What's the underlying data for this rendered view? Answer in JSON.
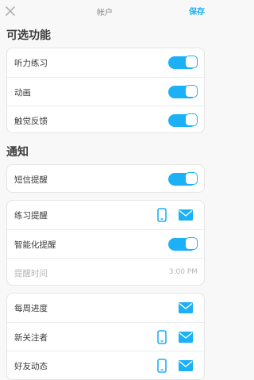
{
  "header": {
    "title": "帐户",
    "save_label": "保存"
  },
  "optional_features": {
    "title": "可选功能",
    "items": [
      {
        "label": "听力练习",
        "enabled": true
      },
      {
        "label": "动画",
        "enabled": true
      },
      {
        "label": "触觉反馈",
        "enabled": true
      }
    ]
  },
  "notifications": {
    "title": "通知",
    "sms": {
      "label": "短信提醒",
      "enabled": true
    },
    "practice": {
      "label": "练习提醒",
      "smart_label": "智能化提醒",
      "smart_enabled": true,
      "time_label": "提醒时间",
      "time_value": "3:00 PM"
    },
    "list": [
      {
        "label": "每周进度"
      },
      {
        "label": "新关注者"
      },
      {
        "label": "好友动态"
      }
    ]
  },
  "colors": {
    "accent": "#1cb0f6",
    "text": "#3c3c3c",
    "muted": "#b5b5b5"
  },
  "icons": [
    "close-icon",
    "phone-icon",
    "mail-icon"
  ]
}
